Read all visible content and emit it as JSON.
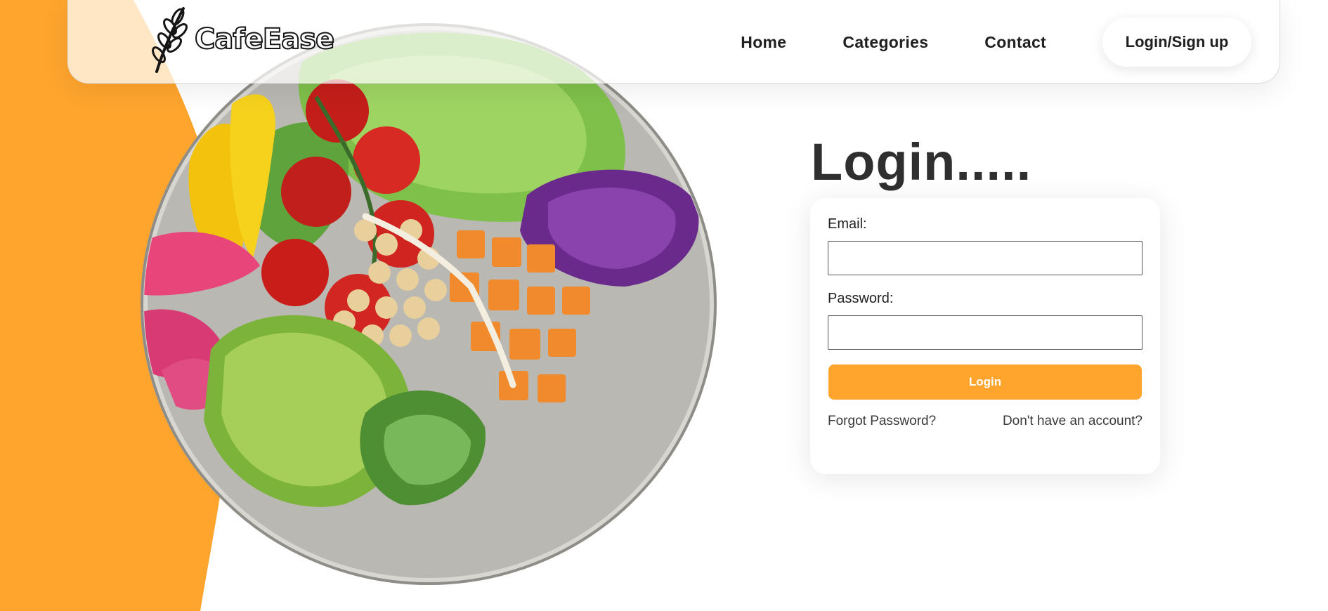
{
  "brand": {
    "name": "CafeEase",
    "logo_icon": "wheat-icon"
  },
  "nav": {
    "links": [
      {
        "label": "Home"
      },
      {
        "label": "Categories"
      },
      {
        "label": "Contact"
      }
    ],
    "cta_label": "Login/Sign up"
  },
  "hero": {
    "image": "salad-bowl-image"
  },
  "login": {
    "title": "Login.....",
    "email_label": "Email:",
    "email_value": "",
    "password_label": "Password:",
    "password_value": "",
    "submit_label": "Login",
    "forgot_label": "Forgot Password?",
    "signup_label": "Don't have an account?"
  },
  "colors": {
    "accent": "#ffa52d",
    "text": "#2f2f2f",
    "background": "#ffffff"
  }
}
